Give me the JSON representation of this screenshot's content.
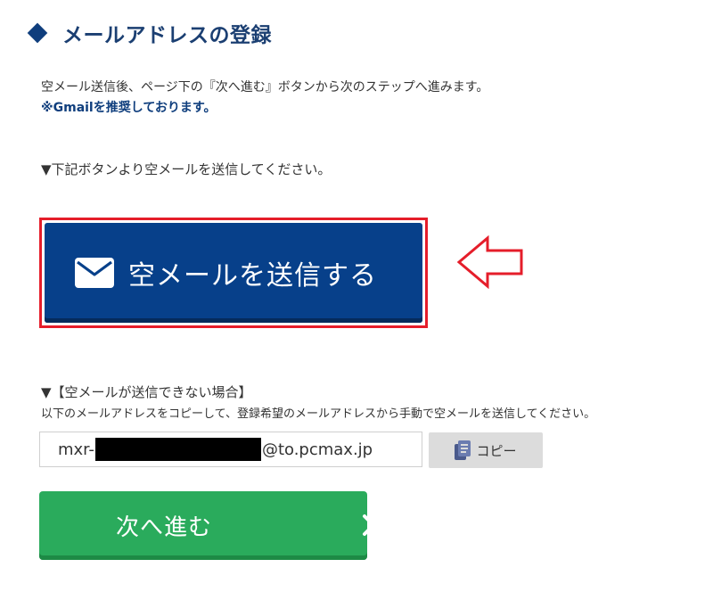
{
  "section": {
    "title": "メールアドレスの登録"
  },
  "intro": {
    "text": "空メール送信後、ページ下の『次へ進む』ボタンから次のステップへ進みます。",
    "recommend": "※Gmailを推奨しております。"
  },
  "instruction": "▼下記ボタンより空メールを送信してください。",
  "send_button": {
    "label": "空メールを送信する",
    "icon": "envelope-icon",
    "frame_color": "#e51d2a",
    "bg_color": "#07408a"
  },
  "pointer_arrow": {
    "icon": "left-arrow-outline-icon",
    "color": "#e51d2a"
  },
  "fallback": {
    "title": "▼【空メールが送信できない場合】",
    "description": "以下のメールアドレスをコピーして、登録希望のメールアドレスから手動で空メールを送信してください。",
    "email_prefix": "mxr-",
    "email_suffix": "@to.pcmax.jp",
    "copy_label": "コピー",
    "copy_icon": "copy-icon"
  },
  "next_button": {
    "label": "次へ進む",
    "icon": "chevron-right-icon",
    "bg_color": "#2aab5c"
  }
}
